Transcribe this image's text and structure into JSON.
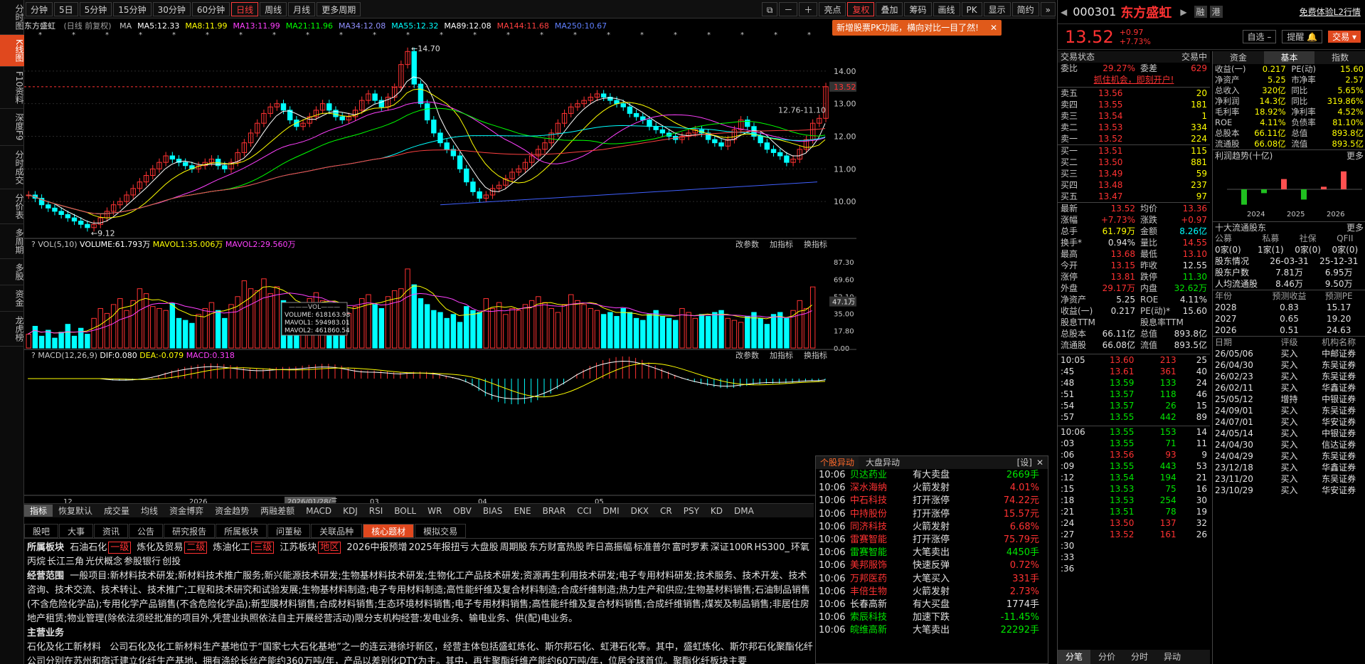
{
  "left_nav": [
    "分时图",
    "K线图",
    "F10资料",
    "深度F9",
    "分时成交",
    "分价表",
    "多周期",
    "多股",
    "资金",
    "龙虎榜"
  ],
  "toolbar": {
    "periods": [
      "分钟",
      "5日",
      "5分钟",
      "15分钟",
      "30分钟",
      "60分钟",
      "日线",
      "周线",
      "月线",
      "更多周期"
    ],
    "right": [
      "亮点",
      "复权",
      "叠加",
      "筹码",
      "画线",
      "PK",
      "显示",
      "简约"
    ]
  },
  "stock": {
    "code": "000301",
    "name": "东方盛虹",
    "price": "13.52",
    "chg": "+0.97",
    "pct": "+7.73%",
    "header_label": "东方盛虹",
    "header_sub": "(日线 前复权)"
  },
  "ma": [
    "MA",
    "MA5:12.33",
    "MA8:11.99",
    "MA13:11.99",
    "MA21:11.96",
    "MA34:12.08",
    "MA55:12.32",
    "MA89:12.08",
    "MA144:11.68",
    "MA250:10.67"
  ],
  "pk_popup": "新增股票PK功能，横向对比一目了然!",
  "chart_data": {
    "type": "candlestick",
    "title": "东方盛虹 (日线 前复权)",
    "y_ticks": [
      "14.00",
      "13.00",
      "12.00",
      "11.00",
      "10.00"
    ],
    "annotations": {
      "high": "14.70",
      "low": "9.12",
      "range": "12.76-11.10",
      "last": "13.52"
    },
    "x_labels": [
      "12",
      "2026",
      "2026/01/28/三",
      "03",
      "04",
      "05"
    ],
    "vol_title": "VOL(5,10)",
    "vol_values": [
      "VOLUME:61.793万",
      "MAVOL1:35.006万",
      "MAVOL2:29.560万"
    ],
    "vol_ticks": [
      "87.30",
      "69.60",
      "52.10",
      "35.00",
      "17.80",
      "0.00"
    ],
    "vol_mark": "47.1万",
    "vol_tooltip": {
      "head": "VOL",
      "rows": [
        "VOLUME: 618163.98",
        "MAVOL1: 594983.01",
        "MAVOL2: 461860.54"
      ]
    },
    "macd_title": "MACD(12,26,9)",
    "macd_values": [
      "DIF:0.080",
      "DEA:-0.079",
      "MACD:0.318"
    ],
    "panel_tools": [
      "改参数",
      "加指标",
      "换指标"
    ],
    "prices": [
      10.2,
      10.1,
      9.9,
      9.8,
      9.7,
      9.6,
      9.5,
      9.4,
      9.3,
      9.2,
      9.3,
      9.5,
      9.7,
      9.9,
      10.0,
      10.2,
      10.4,
      10.6,
      10.8,
      11.0,
      11.2,
      11.4,
      11.3,
      11.2,
      11.1,
      11.0,
      11.1,
      11.2,
      11.3,
      11.1,
      11.0,
      11.2,
      11.5,
      11.8,
      12.1,
      12.4,
      12.7,
      12.9,
      13.0,
      12.8,
      12.5,
      12.3,
      12.4,
      12.6,
      12.8,
      13.0,
      12.8,
      12.6,
      12.5,
      12.6,
      12.8,
      13.1,
      13.3,
      13.1,
      12.9,
      13.2,
      13.5,
      14.2,
      14.6,
      13.6,
      13.0,
      12.5,
      12.1,
      11.8,
      11.6,
      11.4,
      11.0,
      10.6,
      10.3,
      10.1,
      10.2,
      10.4,
      10.5,
      10.7,
      10.9,
      11.0,
      11.2,
      11.4,
      11.6,
      11.8,
      12.1,
      12.4,
      12.7,
      12.9,
      13.0,
      13.1,
      13.2,
      13.3,
      13.2,
      13.1,
      13.0,
      12.9,
      12.7,
      12.6,
      12.5,
      12.3,
      12.2,
      12.1,
      12.0,
      11.9,
      12.0,
      12.1,
      12.2,
      12.1,
      11.9,
      11.8,
      11.7,
      11.9,
      12.2,
      12.5,
      12.3,
      12.0,
      11.8,
      11.6,
      11.5,
      11.4,
      11.2,
      11.3,
      11.6,
      11.9,
      12.4,
      12.55,
      13.52
    ],
    "volumes": [
      14,
      22,
      12,
      18,
      10,
      16,
      24,
      12,
      20,
      14,
      30,
      40,
      35,
      44,
      50,
      38,
      48,
      60,
      55,
      42,
      40,
      38,
      45,
      30,
      28,
      25,
      34,
      40,
      46,
      38,
      30,
      44,
      52,
      68,
      60,
      58,
      70,
      55,
      62,
      48,
      40,
      36,
      42,
      50,
      56,
      48,
      40,
      44,
      38,
      35,
      42,
      50,
      54,
      44,
      40,
      52,
      58,
      60,
      80,
      64,
      50,
      44,
      38,
      36,
      30,
      34,
      26,
      42,
      38,
      36,
      50,
      40,
      46,
      34,
      40,
      38,
      44,
      48,
      52,
      46,
      40,
      36,
      44,
      54,
      48,
      44,
      40,
      38,
      34,
      36,
      32,
      40,
      36,
      30,
      28,
      34,
      38,
      32,
      30,
      28,
      40,
      36,
      30,
      34,
      32,
      36,
      38,
      30,
      28,
      26,
      32,
      36,
      30,
      24,
      34,
      36,
      30,
      38,
      48,
      40,
      61.8
    ]
  },
  "bottom_tabs": [
    "指标",
    "恢复默认",
    "成交量",
    "均线",
    "资金博弈",
    "资金趋势",
    "两融差额",
    "MACD",
    "KDJ",
    "RSI",
    "BOLL",
    "WR",
    "OBV",
    "BIAS",
    "ENE",
    "BRAR",
    "CCI",
    "DMI",
    "DKX",
    "CR",
    "PSY",
    "KD",
    "DMA"
  ],
  "f10_tabs": [
    "股吧",
    "大事",
    "资讯",
    "公告",
    "研究报告",
    "所属板块",
    "问董秘",
    "关联品种",
    "核心题材",
    "模拟交易"
  ],
  "f10": {
    "sector_label": "所属板块",
    "sectors": [
      "石油石化",
      "一级",
      "炼化及贸易",
      "二级",
      "炼油化工",
      "三级",
      "江苏板块",
      "地区",
      "2026中报预增",
      "2025年报扭亏",
      "大盘股",
      "周期股",
      "东方财富热股",
      "昨日高振幅",
      "标准普尔",
      "富时罗素",
      "深证100R",
      "HS300_",
      "环氧丙烷",
      "长江三角",
      "光伏概念",
      "参股银行",
      "创投"
    ],
    "scope_label": "经营范围",
    "scope": "一般项目:新材料技术研发;新材料技术推广服务;新兴能源技术研发;生物基材料技术研发;生物化工产品技术研发;资源再生利用技术研发;电子专用材料研发;技术服务、技术开发、技术咨询、技术交流、技术转让、技术推广;工程和技术研究和试验发展;生物基材料制造;电子专用材料制造;高性能纤维及复合材料制造;合成纤维制造;热力生产和供应;生物基材料销售;石油制品销售(不含危险化学品);专用化学产品销售(不含危险化学品);新型膜材料销售;合成材料销售;生态环境材料销售;电子专用材料销售;高性能纤维及复合材料销售;合成纤维销售;煤炭及制品销售;非居住房地产租赁;物业管理(除依法须经批准的项目外,凭营业执照依法自主开展经营活动)限分支机构经营:发电业务、输电业务、供(配)电业务。",
    "main_label": "主营业务",
    "main_title": "石化及化工新材料",
    "main": "公司石化及化工新材料生产基地位于“国家七大石化基地”之一的连云港徐圩新区，经营主体包括盛虹炼化、斯尔邦石化、虹港石化等。其中，盛虹炼化、斯尔邦石化聚酯化纤  公司分别在苏州和宿迁建立化纤生产基地，拥有涤纶长丝产能约360万吨/年，产品以差别化DTY为主。其中，再生聚酯纤维产能约60万吨/年，位居全球首位。聚酯化纤板块主要"
  },
  "yidong": {
    "tabs": [
      "个股异动",
      "大盘异动"
    ],
    "setting": "[设]",
    "rows": [
      [
        "10:06",
        "贝达药业",
        "有大卖盘",
        "2669手"
      ],
      [
        "10:06",
        "深水海纳",
        "火箭发射",
        "4.01%"
      ],
      [
        "10:06",
        "中石科技",
        "打开涨停",
        "74.22元"
      ],
      [
        "10:06",
        "中持股份",
        "打开涨停",
        "15.57元"
      ],
      [
        "10:06",
        "同济科技",
        "火箭发射",
        "6.68%"
      ],
      [
        "10:06",
        "雷赛智能",
        "打开涨停",
        "75.79元"
      ],
      [
        "10:06",
        "雷赛智能",
        "大笔卖出",
        "4450手"
      ],
      [
        "10:06",
        "美邦服饰",
        "快速反弹",
        "0.72%"
      ],
      [
        "10:06",
        "万邦医药",
        "大笔买入",
        "331手"
      ],
      [
        "10:06",
        "丰倍生物",
        "火箭发射",
        "2.73%"
      ],
      [
        "10:06",
        "长春高新",
        "有大买盘",
        "1774手"
      ],
      [
        "10:06",
        "索辰科技",
        "加速下跌",
        "-11.45%"
      ],
      [
        "10:06",
        "皖维高新",
        "大笔卖出",
        "22292手"
      ]
    ]
  },
  "rp": {
    "top_btns": [
      "融",
      "港"
    ],
    "trial": "免费体验L2行情",
    "self": "自选",
    "remind": "提醒",
    "trade": "交易",
    "tabs_left": [
      "交易状态",
      "交易中"
    ],
    "ratio": [
      "委比",
      "29.27%",
      "委差",
      "629"
    ],
    "ad": "抓住机会，即刻开户!",
    "sell": [
      [
        "卖五",
        "13.56",
        "20"
      ],
      [
        "卖四",
        "13.55",
        "181"
      ],
      [
        "卖三",
        "13.54",
        "1"
      ],
      [
        "卖二",
        "13.53",
        "334"
      ],
      [
        "卖一",
        "13.52",
        "224"
      ]
    ],
    "buy": [
      [
        "买一",
        "13.51",
        "115"
      ],
      [
        "买二",
        "13.50",
        "881"
      ],
      [
        "买三",
        "13.49",
        "59"
      ],
      [
        "买四",
        "13.48",
        "237"
      ],
      [
        "买五",
        "13.47",
        "97"
      ]
    ],
    "stats": [
      [
        "最新",
        "13.52",
        "均价",
        "13.36"
      ],
      [
        "涨幅",
        "+7.73%",
        "涨跌",
        "+0.97"
      ],
      [
        "总手",
        "61.79万",
        "金额",
        "8.26亿"
      ],
      [
        "换手*",
        "0.94%",
        "量比",
        "14.55"
      ],
      [
        "最高",
        "13.68",
        "最低",
        "13.10"
      ],
      [
        "今开",
        "13.15",
        "昨收",
        "12.55"
      ],
      [
        "涨停",
        "13.81",
        "跌停",
        "11.30"
      ],
      [
        "外盘",
        "29.17万",
        "内盘",
        "32.62万"
      ],
      [
        "净资产",
        "5.25",
        "ROE",
        "4.11%"
      ],
      [
        "收益(一)",
        "0.217",
        "PE(动)*",
        "15.60"
      ],
      [
        "股息TTM",
        "",
        "股息率TTM",
        ""
      ],
      [
        "总股本",
        "66.11亿",
        "总值",
        "893.8亿"
      ],
      [
        "流通股",
        "66.08亿",
        "流值",
        "893.5亿"
      ]
    ],
    "ticks1": [
      [
        "10:05",
        "13.60",
        "213",
        "25"
      ],
      [
        ":45",
        "13.61",
        "361",
        "40"
      ],
      [
        ":48",
        "13.59",
        "133",
        "24"
      ],
      [
        ":51",
        "13.57",
        "118",
        "46"
      ],
      [
        ":54",
        "13.57",
        "26",
        "15"
      ],
      [
        ":57",
        "13.55",
        "442",
        "89"
      ]
    ],
    "ticks2": [
      [
        "10:06",
        "13.55",
        "153",
        "14"
      ],
      [
        ":03",
        "13.55",
        "71",
        "11"
      ],
      [
        ":06",
        "13.56",
        "93",
        "9"
      ],
      [
        ":09",
        "13.55",
        "443",
        "53"
      ],
      [
        ":12",
        "13.54",
        "194",
        "21"
      ],
      [
        ":15",
        "13.53",
        "75",
        "16"
      ],
      [
        ":18",
        "13.53",
        "254",
        "30"
      ],
      [
        ":21",
        "13.51",
        "78",
        "19"
      ],
      [
        ":24",
        "13.50",
        "137",
        "32"
      ],
      [
        ":27",
        "13.52",
        "161",
        "26"
      ],
      [
        ":30",
        "",
        "",
        " "
      ],
      [
        ":33",
        "",
        "",
        ""
      ],
      [
        ":36",
        "",
        "",
        ""
      ]
    ],
    "bottom_tabs": [
      "分笔",
      "分价",
      "分时",
      "异动"
    ],
    "fund_tabs": [
      "资金",
      "基本",
      "指数"
    ],
    "fund": [
      [
        "收益(一)",
        "0.217",
        "PE(动)",
        "15.60"
      ],
      [
        "净资产",
        "5.25",
        "市净率",
        "2.57"
      ],
      [
        "总收入",
        "320亿",
        "同比",
        "5.65%"
      ],
      [
        "净利润",
        "14.3亿",
        "同比",
        "319.86%"
      ],
      [
        "毛利率",
        "18.92%",
        "净利率",
        "4.52%"
      ],
      [
        "ROE",
        "4.11%",
        "负债率",
        "81.10%"
      ],
      [
        "总股本",
        "66.11亿",
        "总值",
        "893.8亿"
      ],
      [
        "流通股",
        "66.08亿",
        "流值",
        "893.5亿"
      ]
    ],
    "profit_title": "利润趋势(十亿)",
    "more": "更多",
    "profit_years": [
      "2024",
      "2025",
      "2026"
    ],
    "profit_vals": [
      -1.2,
      -0.3,
      0.8,
      -0.8,
      0.2,
      1.4
    ],
    "sh_title": "十大流通股东",
    "sh_head": [
      "公募",
      "私募",
      "社保",
      "QFII"
    ],
    "sh_vals": [
      "0家(0)",
      "1家(1)",
      "0家(0)",
      "0家(0)"
    ],
    "holders": [
      [
        "股东情况",
        "26-03-31",
        "25-12-31"
      ],
      [
        "股东户数",
        "7.81万",
        "6.95万"
      ],
      [
        "人均流通股",
        "8.46万",
        "9.50万"
      ]
    ],
    "fc_head": [
      "年份",
      "预测收益",
      "预测PE"
    ],
    "fc": [
      [
        "2028",
        "0.83",
        "15.17"
      ],
      [
        "2027",
        "0.65",
        "19.20"
      ],
      [
        "2026",
        "0.51",
        "24.63"
      ]
    ],
    "rt_head": [
      "日期",
      "评级",
      "机构名称"
    ],
    "rt": [
      [
        "26/05/06",
        "买入",
        "中邮证券"
      ],
      [
        "26/04/30",
        "买入",
        "东吴证券"
      ],
      [
        "26/02/23",
        "买入",
        "东吴证券"
      ],
      [
        "26/02/11",
        "买入",
        "华鑫证券"
      ],
      [
        "25/05/12",
        "增持",
        "中银证券"
      ],
      [
        "24/09/01",
        "买入",
        "东吴证券"
      ],
      [
        "24/07/01",
        "买入",
        "华安证券"
      ],
      [
        "24/05/14",
        "买入",
        "中银证券"
      ],
      [
        "24/04/30",
        "买入",
        "信达证券"
      ],
      [
        "24/04/29",
        "买入",
        "东吴证券"
      ],
      [
        "23/12/18",
        "买入",
        "华鑫证券"
      ],
      [
        "23/11/20",
        "买入",
        "东吴证券"
      ],
      [
        "23/10/29",
        "买入",
        "华安证券"
      ]
    ]
  }
}
